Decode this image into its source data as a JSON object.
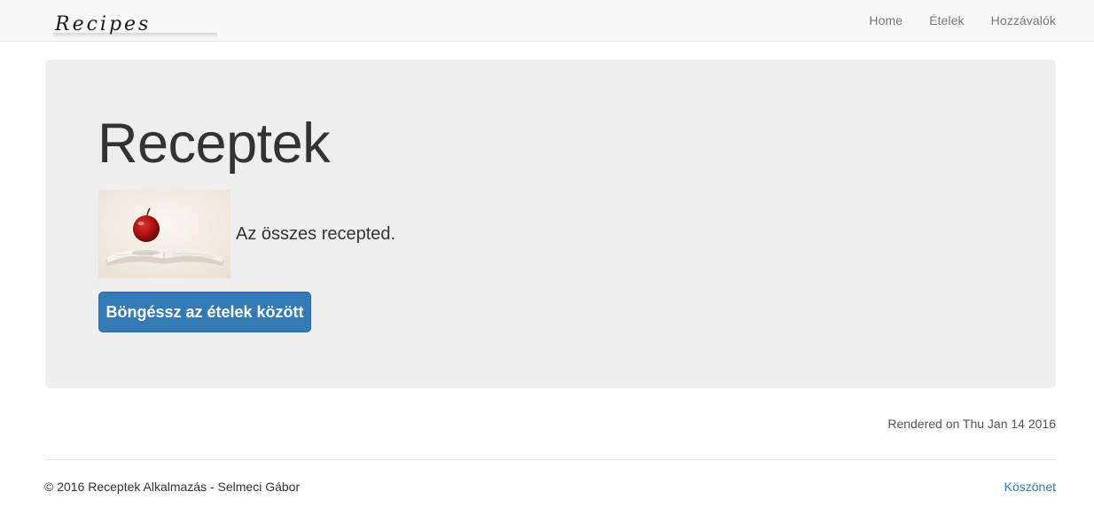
{
  "navbar": {
    "brand_text": "Recipes",
    "links": [
      {
        "label": "Home"
      },
      {
        "label": "Ételek"
      },
      {
        "label": "Hozzávalók"
      }
    ]
  },
  "jumbotron": {
    "title": "Receptek",
    "lead": "Az összes recepted.",
    "button_label": "Böngéssz az ételek között"
  },
  "rendered_text": "Rendered on Thu Jan 14 2016",
  "footer": {
    "copyright": "© 2016 Receptek Alkalmazás - Selmeci Gábor",
    "thanks_link": "Köszönet"
  },
  "colors": {
    "primary": "#337ab7",
    "jumbotron_bg": "#eeeeee",
    "navbar_bg": "#f8f8f8"
  }
}
